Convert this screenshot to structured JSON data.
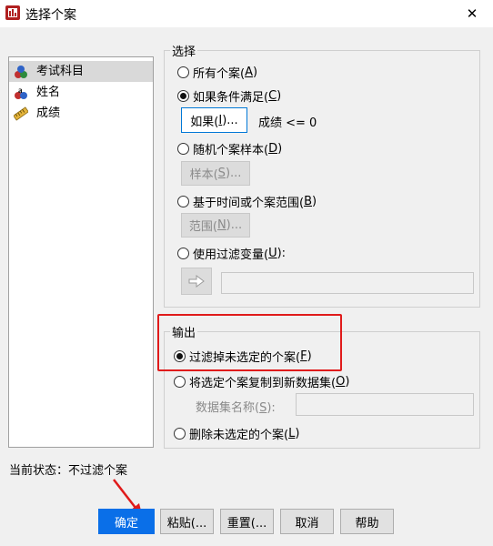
{
  "window": {
    "title": "选择个案",
    "close_label": "✕"
  },
  "variables": [
    {
      "label": "考试科目",
      "icon": "nominal-variable-icon",
      "selected": true
    },
    {
      "label": "姓名",
      "icon": "string-variable-icon",
      "selected": false
    },
    {
      "label": "成绩",
      "icon": "scale-variable-icon",
      "selected": false
    }
  ],
  "select_group": {
    "legend": "选择",
    "all_cases": {
      "text": "所有个案(",
      "key": "A",
      "end": ")"
    },
    "if_condition": {
      "text": "如果条件满足(",
      "key": "C",
      "end": ")"
    },
    "if_button": {
      "text": "如果(",
      "key": "I",
      "end": ")..."
    },
    "condition_text": "成绩 <= 0",
    "random_sample": {
      "text": "随机个案样本(",
      "key": "D",
      "end": ")"
    },
    "sample_button": {
      "text": "样本(",
      "key": "S",
      "end": ")..."
    },
    "time_range": {
      "text": "基于时间或个案范围(",
      "key": "B",
      "end": ")"
    },
    "range_button": {
      "text": "范围(",
      "key": "N",
      "end": ")..."
    },
    "filter_variable": {
      "text": "使用过滤变量(",
      "key": "U",
      "end": "):"
    }
  },
  "output_group": {
    "legend": "输出",
    "filter_out": {
      "text": "过滤掉未选定的个案(",
      "key": "F",
      "end": ")"
    },
    "copy_to_dataset": {
      "text": "将选定个案复制到新数据集(",
      "key": "O",
      "end": ")"
    },
    "dataset_name": {
      "text": "数据集名称(",
      "key": "S",
      "end": "):"
    },
    "delete_unselected": {
      "text": "删除未选定的个案(",
      "key": "L",
      "end": ")"
    }
  },
  "status": "当前状态：不过滤个案",
  "buttons": {
    "ok": "确定",
    "paste": "粘贴(...",
    "reset": "重置(...",
    "cancel": "取消",
    "help": "帮助"
  },
  "colors": {
    "primary": "#0a6fe8",
    "highlight": "#e01b1b"
  }
}
